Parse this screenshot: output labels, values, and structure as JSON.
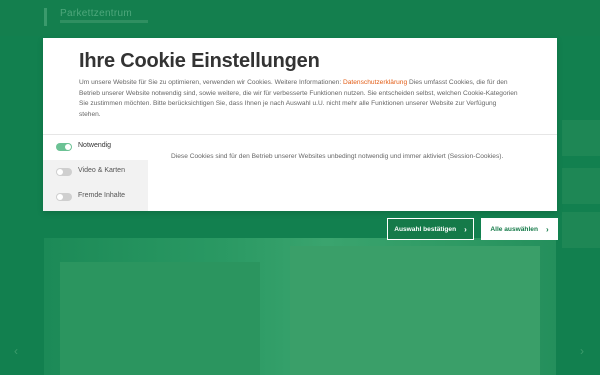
{
  "background": {
    "logo_text": "Parkettzentrum",
    "nav_prev_icon": "chevron-left-icon",
    "nav_next_icon": "chevron-right-icon"
  },
  "cookie_modal": {
    "title": "Ihre Cookie Einstellungen",
    "description_before": "Um unsere Website für Sie zu optimieren, verwenden wir Cookies. Weitere Informationen: ",
    "privacy_link": "Datenschutzerklärung",
    "description_after": " Dies umfasst Cookies, die für den Betrieb unserer Website notwendig sind, sowie weitere, die wir für verbesserte Funktionen nutzen. Sie entscheiden selbst, welchen Cookie-Kategorien Sie zustimmen möchten. Bitte berücksichtigen Sie, dass Ihnen je nach Auswahl u.U. nicht mehr alle Funktionen unserer Website zur Verfügung stehen.",
    "categories": [
      {
        "label": "Notwendig",
        "enabled": true,
        "active": true
      },
      {
        "label": "Video & Karten",
        "enabled": false,
        "active": false
      },
      {
        "label": "Fremde Inhalte",
        "enabled": false,
        "active": false
      }
    ],
    "category_description": "Diese Cookies sind für den Betrieb unserer Websites unbedingt notwendig und immer aktiviert (Session-Cookies).",
    "buttons": {
      "confirm_selection": "Auswahl bestätigen",
      "select_all": "Alle auswählen"
    }
  },
  "colors": {
    "brand_green": "#157a49",
    "link_orange": "#e25c15",
    "toggle_on": "#6cc295"
  }
}
